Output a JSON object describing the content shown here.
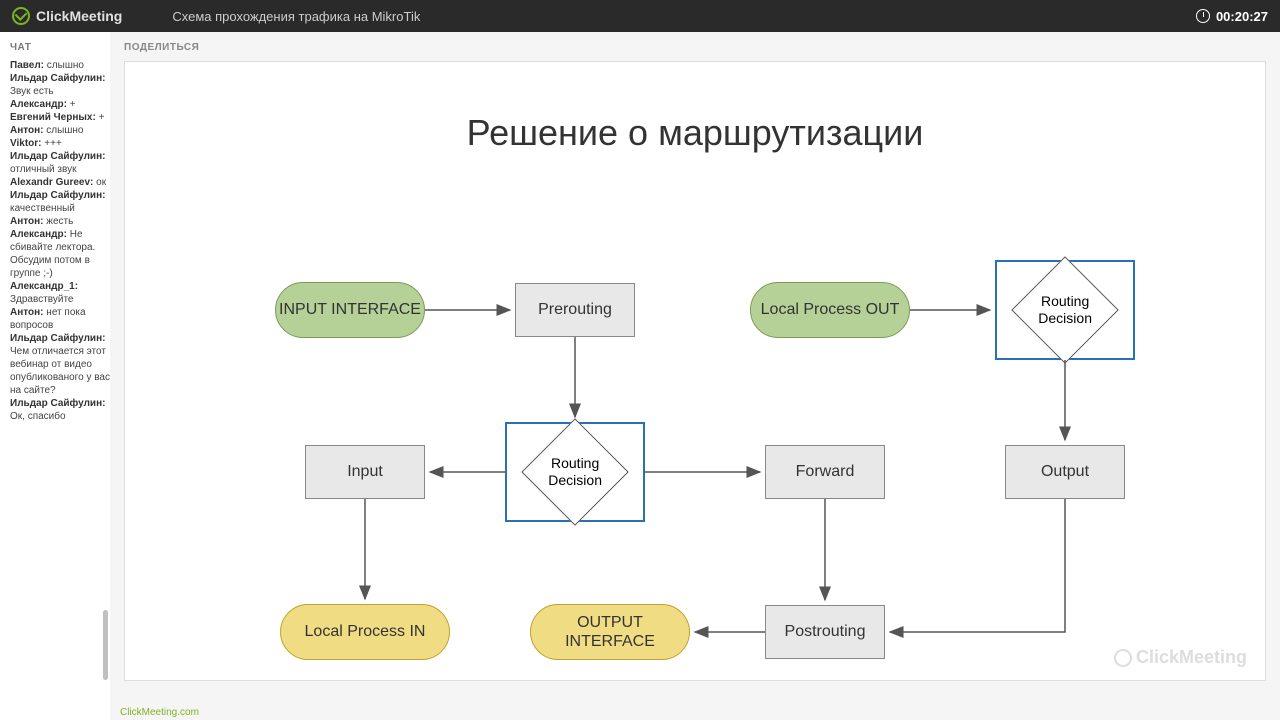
{
  "header": {
    "brand": "ClickMeeting",
    "title": "Схема прохождения трафика на MikroTik",
    "timer": "00:20:27"
  },
  "sidebar": {
    "title": "ЧАТ",
    "messages": [
      {
        "name": "Павел:",
        "msg": "слышно"
      },
      {
        "name": "Ильдар Сайфулин:",
        "msg": "Звук есть"
      },
      {
        "name": "Александр:",
        "msg": "+"
      },
      {
        "name": "Евгений Черных:",
        "msg": "+"
      },
      {
        "name": "Антон:",
        "msg": "слышно"
      },
      {
        "name": "Viktor:",
        "msg": "+++"
      },
      {
        "name": "Ильдар Сайфулин:",
        "msg": "отличный звук"
      },
      {
        "name": "Alexandr Gureev:",
        "msg": "ок"
      },
      {
        "name": "Ильдар Сайфулин:",
        "msg": "качественный"
      },
      {
        "name": "Антон:",
        "msg": "жесть"
      },
      {
        "name": "Александр:",
        "msg": "Не сбивайте лектора. Обсудим потом в группе ;-)"
      },
      {
        "name": "Александр_1:",
        "msg": "Здравствуйте"
      },
      {
        "name": "Антон:",
        "msg": "нет пока вопросов"
      },
      {
        "name": "Ильдар Сайфулин:",
        "msg": "Чем отличается этот вебинар от видео опубликованого у вас на сайте?"
      },
      {
        "name": "Ильдар Сайфулин:",
        "msg": "Ок, спасибо"
      }
    ]
  },
  "content": {
    "title": "ПОДЕЛИТЬСЯ",
    "slide_title": "Решение о маршрутизации",
    "nodes": {
      "input_interface": "INPUT INTERFACE",
      "prerouting": "Prerouting",
      "local_process_out": "Local Process OUT",
      "routing_decision": "Routing Decision",
      "input": "Input",
      "forward": "Forward",
      "output": "Output",
      "local_process_in": "Local Process IN",
      "output_interface": "OUTPUT INTERFACE",
      "postrouting": "Postrouting"
    },
    "watermark": "ClickMeeting"
  },
  "footer_link": "ClickMeeting.com"
}
